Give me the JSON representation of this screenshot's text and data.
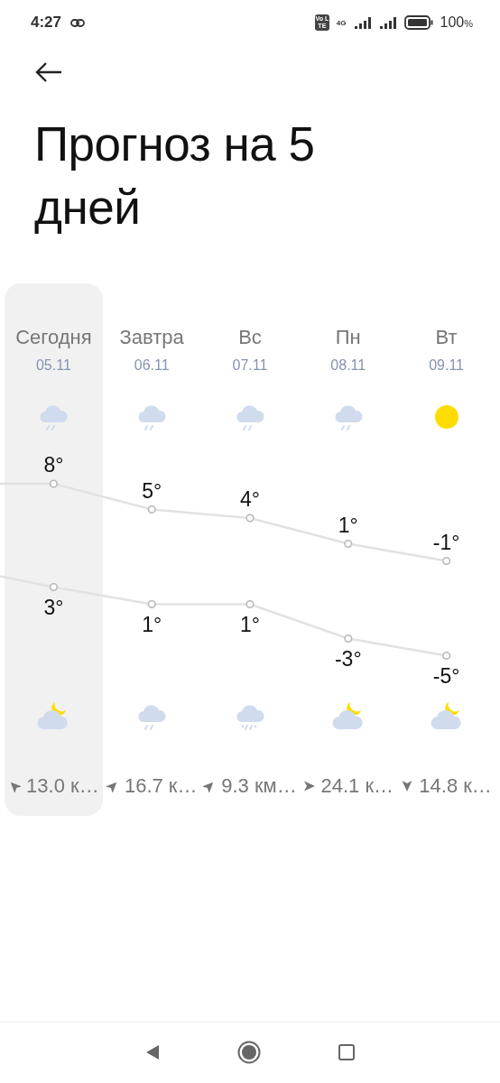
{
  "status_bar": {
    "time": "4:27",
    "volte": "Vo LTE",
    "network": "4G",
    "battery": "100",
    "battery_unit": "%"
  },
  "title": "Прогноз на 5 дней",
  "days": [
    {
      "name": "Сегодня",
      "date": "05.11",
      "selected": true,
      "day_icon": {
        "kind": "rain"
      },
      "high": "8°",
      "low": "3°",
      "night_icon": {
        "kind": "moon"
      },
      "wind_arrow": {
        "kind": "northwest"
      },
      "wind": "13.0 к…"
    },
    {
      "name": "Завтра",
      "date": "06.11",
      "selected": false,
      "day_icon": {
        "kind": "rain"
      },
      "high": "5°",
      "low": "1°",
      "night_icon": {
        "kind": "rain"
      },
      "wind_arrow": {
        "kind": "northeast"
      },
      "wind": "16.7 к…"
    },
    {
      "name": "Вс",
      "date": "07.11",
      "selected": false,
      "day_icon": {
        "kind": "rain"
      },
      "high": "4°",
      "low": "1°",
      "night_icon": {
        "kind": "sleet"
      },
      "wind_arrow": {
        "kind": "northeast"
      },
      "wind": "9.3 км…"
    },
    {
      "name": "Пн",
      "date": "08.11",
      "selected": false,
      "day_icon": {
        "kind": "rain"
      },
      "high": "1°",
      "low": "-3°",
      "night_icon": {
        "kind": "moon"
      },
      "wind_arrow": {
        "kind": "east"
      },
      "wind": "24.1 к…"
    },
    {
      "name": "Вт",
      "date": "09.11",
      "selected": false,
      "day_icon": {
        "kind": "sun"
      },
      "high": "-1°",
      "low": "-5°",
      "night_icon": {
        "kind": "moon"
      },
      "wind_arrow": {
        "kind": "south"
      },
      "wind": "14.8 к…"
    }
  ]
}
